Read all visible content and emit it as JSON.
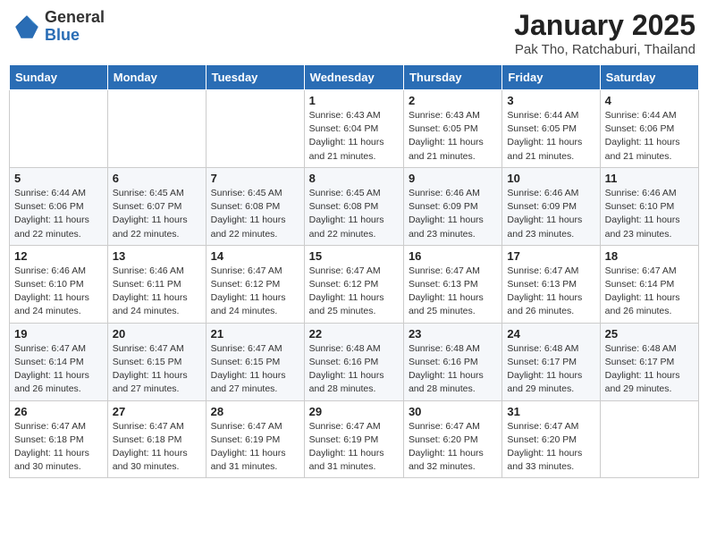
{
  "logo": {
    "general": "General",
    "blue": "Blue"
  },
  "title": {
    "month": "January 2025",
    "location": "Pak Tho, Ratchaburi, Thailand"
  },
  "weekdays": [
    "Sunday",
    "Monday",
    "Tuesday",
    "Wednesday",
    "Thursday",
    "Friday",
    "Saturday"
  ],
  "weeks": [
    [
      {
        "day": "",
        "info": ""
      },
      {
        "day": "",
        "info": ""
      },
      {
        "day": "",
        "info": ""
      },
      {
        "day": "1",
        "info": "Sunrise: 6:43 AM\nSunset: 6:04 PM\nDaylight: 11 hours and 21 minutes."
      },
      {
        "day": "2",
        "info": "Sunrise: 6:43 AM\nSunset: 6:05 PM\nDaylight: 11 hours and 21 minutes."
      },
      {
        "day": "3",
        "info": "Sunrise: 6:44 AM\nSunset: 6:05 PM\nDaylight: 11 hours and 21 minutes."
      },
      {
        "day": "4",
        "info": "Sunrise: 6:44 AM\nSunset: 6:06 PM\nDaylight: 11 hours and 21 minutes."
      }
    ],
    [
      {
        "day": "5",
        "info": "Sunrise: 6:44 AM\nSunset: 6:06 PM\nDaylight: 11 hours and 22 minutes."
      },
      {
        "day": "6",
        "info": "Sunrise: 6:45 AM\nSunset: 6:07 PM\nDaylight: 11 hours and 22 minutes."
      },
      {
        "day": "7",
        "info": "Sunrise: 6:45 AM\nSunset: 6:08 PM\nDaylight: 11 hours and 22 minutes."
      },
      {
        "day": "8",
        "info": "Sunrise: 6:45 AM\nSunset: 6:08 PM\nDaylight: 11 hours and 22 minutes."
      },
      {
        "day": "9",
        "info": "Sunrise: 6:46 AM\nSunset: 6:09 PM\nDaylight: 11 hours and 23 minutes."
      },
      {
        "day": "10",
        "info": "Sunrise: 6:46 AM\nSunset: 6:09 PM\nDaylight: 11 hours and 23 minutes."
      },
      {
        "day": "11",
        "info": "Sunrise: 6:46 AM\nSunset: 6:10 PM\nDaylight: 11 hours and 23 minutes."
      }
    ],
    [
      {
        "day": "12",
        "info": "Sunrise: 6:46 AM\nSunset: 6:10 PM\nDaylight: 11 hours and 24 minutes."
      },
      {
        "day": "13",
        "info": "Sunrise: 6:46 AM\nSunset: 6:11 PM\nDaylight: 11 hours and 24 minutes."
      },
      {
        "day": "14",
        "info": "Sunrise: 6:47 AM\nSunset: 6:12 PM\nDaylight: 11 hours and 24 minutes."
      },
      {
        "day": "15",
        "info": "Sunrise: 6:47 AM\nSunset: 6:12 PM\nDaylight: 11 hours and 25 minutes."
      },
      {
        "day": "16",
        "info": "Sunrise: 6:47 AM\nSunset: 6:13 PM\nDaylight: 11 hours and 25 minutes."
      },
      {
        "day": "17",
        "info": "Sunrise: 6:47 AM\nSunset: 6:13 PM\nDaylight: 11 hours and 26 minutes."
      },
      {
        "day": "18",
        "info": "Sunrise: 6:47 AM\nSunset: 6:14 PM\nDaylight: 11 hours and 26 minutes."
      }
    ],
    [
      {
        "day": "19",
        "info": "Sunrise: 6:47 AM\nSunset: 6:14 PM\nDaylight: 11 hours and 26 minutes."
      },
      {
        "day": "20",
        "info": "Sunrise: 6:47 AM\nSunset: 6:15 PM\nDaylight: 11 hours and 27 minutes."
      },
      {
        "day": "21",
        "info": "Sunrise: 6:47 AM\nSunset: 6:15 PM\nDaylight: 11 hours and 27 minutes."
      },
      {
        "day": "22",
        "info": "Sunrise: 6:48 AM\nSunset: 6:16 PM\nDaylight: 11 hours and 28 minutes."
      },
      {
        "day": "23",
        "info": "Sunrise: 6:48 AM\nSunset: 6:16 PM\nDaylight: 11 hours and 28 minutes."
      },
      {
        "day": "24",
        "info": "Sunrise: 6:48 AM\nSunset: 6:17 PM\nDaylight: 11 hours and 29 minutes."
      },
      {
        "day": "25",
        "info": "Sunrise: 6:48 AM\nSunset: 6:17 PM\nDaylight: 11 hours and 29 minutes."
      }
    ],
    [
      {
        "day": "26",
        "info": "Sunrise: 6:47 AM\nSunset: 6:18 PM\nDaylight: 11 hours and 30 minutes."
      },
      {
        "day": "27",
        "info": "Sunrise: 6:47 AM\nSunset: 6:18 PM\nDaylight: 11 hours and 30 minutes."
      },
      {
        "day": "28",
        "info": "Sunrise: 6:47 AM\nSunset: 6:19 PM\nDaylight: 11 hours and 31 minutes."
      },
      {
        "day": "29",
        "info": "Sunrise: 6:47 AM\nSunset: 6:19 PM\nDaylight: 11 hours and 31 minutes."
      },
      {
        "day": "30",
        "info": "Sunrise: 6:47 AM\nSunset: 6:20 PM\nDaylight: 11 hours and 32 minutes."
      },
      {
        "day": "31",
        "info": "Sunrise: 6:47 AM\nSunset: 6:20 PM\nDaylight: 11 hours and 33 minutes."
      },
      {
        "day": "",
        "info": ""
      }
    ]
  ]
}
